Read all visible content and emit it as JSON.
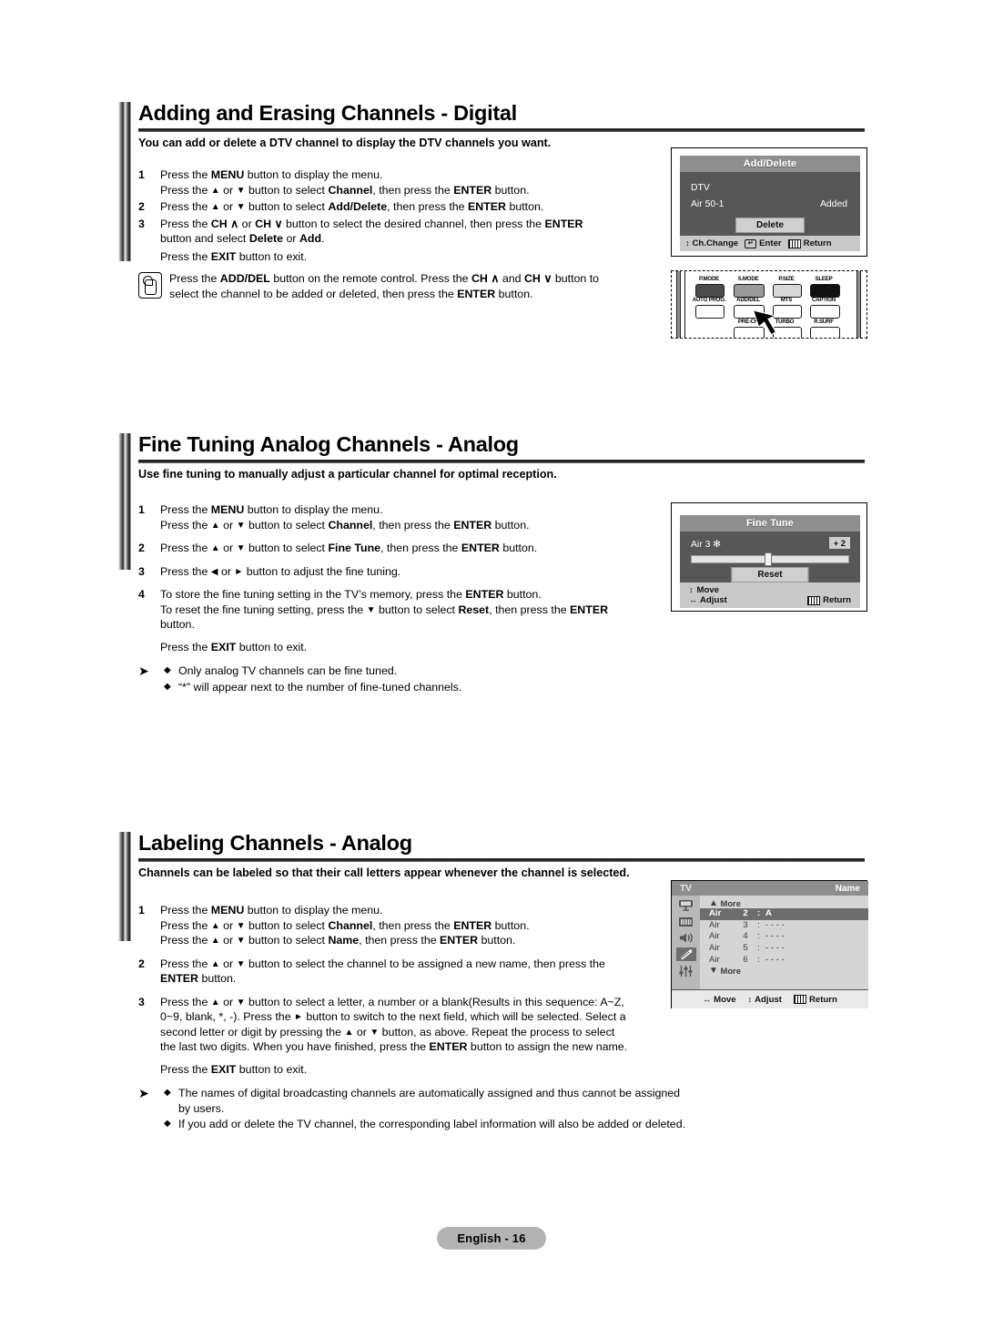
{
  "page": {
    "footer_badge": "English - 16"
  },
  "sections": [
    {
      "id": "add-erase",
      "heading": "Adding and Erasing Channels - Digital",
      "intro": "You can add or delete a DTV channel to display the DTV channels you want.",
      "steps": [
        {
          "num": "1",
          "lines": [
            "Press the MENU button to display the menu.",
            "Press the ▲ or ▼ button to select Channel, then press the ENTER button."
          ]
        },
        {
          "num": "2",
          "lines": [
            "Press the ▲ or ▼ button to select Add/Delete, then press the ENTER button."
          ]
        },
        {
          "num": "3",
          "lines": [
            "Press the CH ∧ or CH ∨ button to select the desired channel, then press the ENTER",
            "button and select Delete or Add."
          ]
        }
      ],
      "exit_line": "Press the EXIT button to exit.",
      "note": {
        "icon": "hand-press-button-icon",
        "lines": [
          "Press the ADD/DEL button on the remote control. Press the CH ∧ and CH ∨ button to",
          "select the channel to be added or deleted, then press the ENTER button."
        ]
      }
    },
    {
      "id": "fine-tuning",
      "heading": "Fine Tuning Analog Channels - Analog",
      "intro": "Use fine tuning to manually adjust a particular channel for optimal reception.",
      "steps": [
        {
          "num": "1",
          "lines": [
            "Press the MENU button to display the menu.",
            "Press the ▲ or ▼ button to select Channel, then press the ENTER button."
          ]
        },
        {
          "num": "2",
          "lines": [
            "Press the ▲ or ▼ button to select Fine Tune, then press the ENTER button."
          ]
        },
        {
          "num": "3",
          "lines": [
            "Press the ◄ or ► button to adjust the fine tuning."
          ]
        },
        {
          "num": "4",
          "lines": [
            "To store the fine tuning setting in the TV’s memory, press the ENTER button.",
            "To reset the fine tuning setting, press the ▼ button to select Reset, then press the ENTER",
            "button."
          ]
        }
      ],
      "exit_line": "Press the EXIT button to exit.",
      "tips": [
        "Only analog TV channels can be fine tuned.",
        "“*” will appear next to the number of fine-tuned channels."
      ]
    },
    {
      "id": "labeling",
      "heading": "Labeling Channels - Analog",
      "intro": "Channels can be labeled so that their call letters appear whenever the channel is selected.",
      "steps": [
        {
          "num": "1",
          "lines": [
            "Press the MENU button to display the menu.",
            "Press the ▲ or ▼ button to select Channel, then press the ENTER button.",
            "Press the ▲ or ▼ button to select Name, then press the ENTER button."
          ]
        },
        {
          "num": "2",
          "lines": [
            "Press the ▲ or ▼ button to select the channel to be assigned a new name, then press the",
            "ENTER button."
          ]
        },
        {
          "num": "3",
          "lines": [
            "Press the ▲ or ▼ button to select a letter, a number or a blank(Results in this sequence: A~Z,",
            "0~9, blank, *, -). Press the ► button to switch to the next field, which will be selected. Select a",
            "second letter or digit by pressing the ▲ or ▼ button, as above. Repeat the process to select",
            "the last two digits. When you have finished, press the ENTER button to assign the new name."
          ]
        }
      ],
      "exit_line": "Press the EXIT button to exit.",
      "tips": [
        "The names of digital broadcasting channels are automatically assigned and thus cannot be assigned by users.",
        "If you add or delete the TV channel, the corresponding label information will also be added or deleted."
      ]
    }
  ],
  "osd": {
    "add_delete": {
      "title": "Add/Delete",
      "source": "DTV",
      "channel": "Air 50-1",
      "state": "Added",
      "button": "Delete",
      "footer": {
        "ch_change": "Ch.Change",
        "enter": "Enter",
        "return": "Return"
      }
    },
    "fine_tune": {
      "title": "Fine Tune",
      "channel": "Air 3 ✻",
      "value": "+ 2",
      "button": "Reset",
      "footer": {
        "move": "Move",
        "adjust": "Adjust",
        "return": "Return"
      }
    },
    "name": {
      "tv_label": "TV",
      "title": "Name",
      "more_up": "More",
      "more_down": "More",
      "rows": [
        {
          "band": "Air",
          "num": "2",
          "sep": ":",
          "value": "A",
          "selected": true
        },
        {
          "band": "Air",
          "num": "3",
          "sep": ":",
          "value": "- - - -",
          "selected": false
        },
        {
          "band": "Air",
          "num": "4",
          "sep": ":",
          "value": "- - - -",
          "selected": false
        },
        {
          "band": "Air",
          "num": "5",
          "sep": ":",
          "value": "- - - -",
          "selected": false
        },
        {
          "band": "Air",
          "num": "6",
          "sep": ":",
          "value": "- - - -",
          "selected": false
        }
      ],
      "rail_icons": [
        "input-icon",
        "picture-icon",
        "sound-icon",
        "channel-satellite-icon",
        "setup-sliders-icon"
      ],
      "footer": {
        "move": "Move",
        "adjust": "Adjust",
        "return": "Return"
      }
    }
  },
  "remote": {
    "row1": [
      "P.MODE",
      "S.MODE",
      "P.SIZE",
      "SLEEP"
    ],
    "row2": [
      "AUTO PROG.",
      "ADD/DEL",
      "MTS",
      "CAPTION"
    ],
    "row3": [
      "PRE-CH",
      "TURBO",
      "R.SURF"
    ],
    "highlight": "ADD/DEL",
    "colors": {
      "p_mode": "#4c4c4c",
      "s_mode": "#9a9a9a",
      "p_size": "#d8d8d8",
      "sleep": "#111111",
      "plain": "#ffffff"
    }
  }
}
